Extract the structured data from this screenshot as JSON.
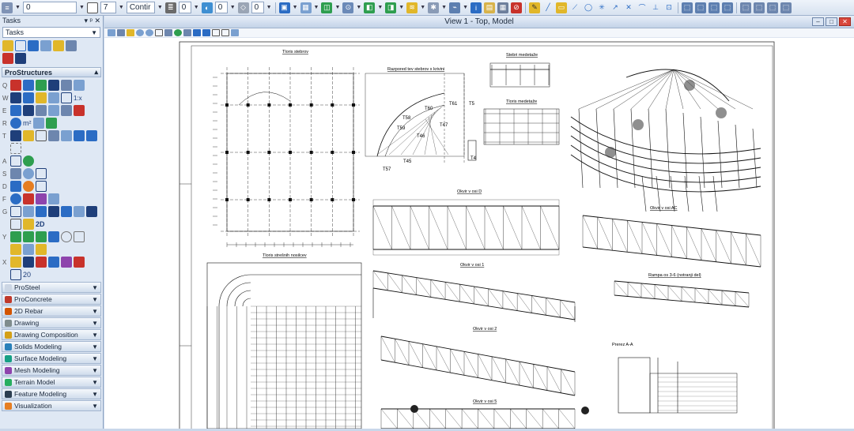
{
  "toolbar": {
    "level_value": "0",
    "color_value": "7",
    "linestyle_value": "Contir",
    "weight_value": "0",
    "transparency_value": "0",
    "priority_value": "0"
  },
  "tasks_panel": {
    "title": "Tasks",
    "pin_glyph": "▾ ᵖ ✕",
    "combo_value": "Tasks",
    "prostructures_label": "ProStructures",
    "row_keys": [
      "Q",
      "W",
      "E",
      "R",
      "T",
      "A",
      "S",
      "D",
      "F",
      "G",
      "Y",
      "X"
    ],
    "row_texts": {
      "r_unit": "m²",
      "text_1x": "1:x",
      "text_2d": "2D",
      "text_20": "20"
    },
    "categories": [
      {
        "label": "ProSteel",
        "icon_color": "#ccd6e4"
      },
      {
        "label": "ProConcrete",
        "icon_color": "#c0392b"
      },
      {
        "label": "2D Rebar",
        "icon_color": "#d35400"
      },
      {
        "label": "Drawing",
        "icon_color": "#7f8c8d"
      },
      {
        "label": "Drawing Composition",
        "icon_color": "#d4a017"
      },
      {
        "label": "Solids Modeling",
        "icon_color": "#2980b9"
      },
      {
        "label": "Surface Modeling",
        "icon_color": "#16a085"
      },
      {
        "label": "Mesh Modeling",
        "icon_color": "#8e44ad"
      },
      {
        "label": "Terrain Model",
        "icon_color": "#27ae60"
      },
      {
        "label": "Feature Modeling",
        "icon_color": "#2c3e50"
      },
      {
        "label": "Visualization",
        "icon_color": "#e67e22"
      }
    ]
  },
  "view": {
    "title": "View 1 - Top, Model",
    "sheet_titles": {
      "plan_columns": "Tloris stebrov",
      "column_layout": "Razpored tev stebrov x krivini",
      "steel_bars": "Stebri medetaže",
      "plan_mezzanine": "Tloris medetaže",
      "frame_d": "Okvir v osi D",
      "frame_ac": "Okvir v osi AC",
      "plan_roof": "Tloris strešnih nosilcev",
      "frame_1": "Okvir v osi 1",
      "ramp": "Rampa os 3-6 (notranji del)",
      "frame_2": "Okvir v osi 2",
      "section_aa": "Prerez A-A",
      "frame_5": "Okvir v osi 5"
    },
    "detail_labels": [
      "T58",
      "T60",
      "T61",
      "T5",
      "T59",
      "T47",
      "T46",
      "T45",
      "T57",
      "T4"
    ],
    "icon_colors": {
      "blue": "#2b6cc4",
      "green": "#2e9e4f",
      "red": "#c8322b",
      "yellow": "#e1b72a",
      "navy": "#1f3f7a"
    }
  }
}
